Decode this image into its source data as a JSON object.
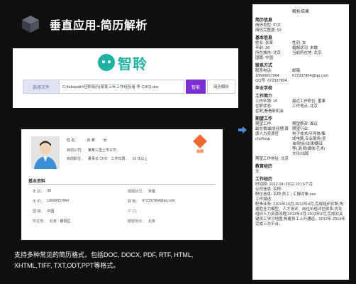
{
  "slide": {
    "title": "垂直应用-简历解析",
    "caption_line1": "支持多种常见的简历格式，包括DOC, DOCX, PDF, RTF, HTML,",
    "caption_line2": "XHTML,TIFF, TXT,ODT,PPT等格式。"
  },
  "logo": {
    "text": "智聆"
  },
  "upload": {
    "label": "选择文件",
    "path": "C:\\fakepath\\任职简历(某某三年工作经验者 李 CHO).doc",
    "parse_button": "智能",
    "select_value": "简历解析"
  },
  "resume": {
    "name_label": "姓 名：",
    "name_value": "张 某",
    "gender_label": "女",
    "company_label": "目前公司：",
    "company_value": "某某三里上市公司",
    "position_label": "目前职位：",
    "position_value": "董事长 CHO",
    "years_label": "工作年限：",
    "years_value": "16 年以上",
    "brand": "猎聘",
    "basic_title": "基本资料",
    "fields": [
      {
        "k": "年 龄：",
        "v": "38"
      },
      {
        "k": "婚姻状况：",
        "v": "未婚"
      },
      {
        "k": "手 机：",
        "v": "18600057064"
      },
      {
        "k": "邮 箱：",
        "v": "672337804@qq.com"
      },
      {
        "k": "国 籍：",
        "v": "中国"
      },
      {
        "k": "户 口：",
        "v": ""
      },
      {
        "k": "所在地：",
        "v": "北京 · 朝阳区"
      },
      {
        "k": "期望地点：",
        "v": "北京"
      }
    ]
  },
  "parsed": {
    "title": "解析结果",
    "sections": [
      {
        "heading": "简历信息",
        "lines": [
          "简历类型: 中文",
          "简历完整度: 59"
        ]
      },
      {
        "heading": "基本信息",
        "pairs": [
          [
            "姓名: 张某",
            "性别: 女"
          ],
          [
            "年龄: 38",
            "婚姻状况: 未婚"
          ],
          [
            "所在城市: 北京",
            "当前所在地: 北京"
          ]
        ],
        "lines": [
          "国籍: 中国"
        ]
      },
      {
        "heading": "联系方式",
        "pairs": [
          [
            "联系电话:",
            "邮箱:"
          ],
          [
            "18600057064",
            "672337804@qq.com"
          ]
        ],
        "lines": [
          "QQ号: 672337804"
        ]
      },
      {
        "heading": "毕业学校",
        "lines": []
      },
      {
        "heading": "工作简介",
        "pairs": [
          [
            "工作年限: 16",
            "最近工作职位: 董事"
          ],
          [
            "在职状态:",
            "工作地点: 北京"
          ]
        ],
        "lines": [
          "在职,看看新机会"
        ]
      },
      {
        "heading": "期望工作",
        "pairs": [
          [
            "期望工作:",
            "期望薪资: 面议"
          ],
          [
            "副总裁/副总经理,首",
            "期望行业:"
          ],
          [
            "席人力资源官",
            "电子技术/半导体/集"
          ],
          [
            "cho/hrvp",
            "成电路,专业服务(咨"
          ],
          [
            "",
            "询/财会/法律/翻译"
          ],
          [
            "",
            "等),影视/媒体/艺术/"
          ],
          [
            "",
            "文化/出版"
          ]
        ],
        "lines": [
          "期望工作地址: 北京"
        ]
      },
      {
        "heading": "教育经历",
        "lines": [
          "无"
        ]
      }
    ],
    "work_heading": "工作经历",
    "work_lines": [
      "时间段: 2012.04~2012.10 | 6个月",
      "公司信息: 名称:",
      "职位信息: 名称:员工 | 汇报对象:ceo",
      "工作描述:"
    ],
    "work_desc": "职责业务: 2101年10月-2012年4月,完成组织诊断,构建胜任力模型、人才测评、岗位价值评估体系,优化组织人力资源流程;2013年4月-2013年9月,完成对关键员工学习地图,构建员工上升通道。2012年-2014年完成三次平台。"
  }
}
